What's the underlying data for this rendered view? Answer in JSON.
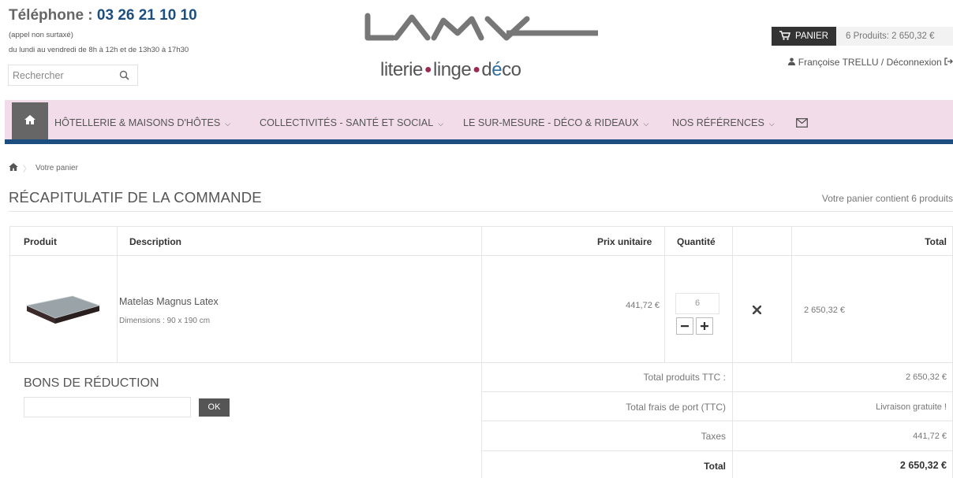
{
  "header": {
    "phone_label": "Téléphone : ",
    "phone_number": "03 26 21 10 10",
    "note1": "(appel non surtaxé)",
    "note2": "du lundi au vendredi de 8h à 12h et de 13h30 à 17h30",
    "search_placeholder": "Rechercher"
  },
  "logo": {
    "word1": "literie",
    "word2": "linge",
    "word3_start": "d",
    "word3_accent": "é",
    "word3_end": "co"
  },
  "cart": {
    "button_label": "PANIER",
    "summary": "6 Produits: 2 650,32 €"
  },
  "user": {
    "text": "Françoise TRELLU / Déconnexion"
  },
  "nav": {
    "items": [
      "HÔTELLERIE & MAISONS D'HÔTES",
      "COLLECTIVITÉS - SANTÉ ET SOCIAL",
      "LE SUR-MESURE - DÉCO & RIDEAUX",
      "NOS RÉFÉRENCES"
    ]
  },
  "breadcrumb": {
    "current": "Votre panier"
  },
  "page": {
    "title": "RÉCAPITULATIF DE LA COMMANDE",
    "count_text": "Votre panier contient 6 produits"
  },
  "table": {
    "headers": {
      "product": "Produit",
      "description": "Description",
      "unit_price": "Prix unitaire",
      "quantity": "Quantité",
      "total": "Total"
    },
    "rows": [
      {
        "name": "Matelas Magnus Latex",
        "dimensions": "Dimensions : 90 x 190 cm",
        "unit_price": "441,72 €",
        "quantity": "6",
        "total": "2 650,32 €"
      }
    ]
  },
  "voucher": {
    "title": "BONS DE RÉDUCTION",
    "ok_label": "OK"
  },
  "summary": {
    "products_label": "Total produits TTC :",
    "products_value": "2 650,32 €",
    "shipping_label": "Total frais de port (TTC)",
    "shipping_value": "Livraison gratuite !",
    "taxes_label": "Taxes",
    "taxes_value": "441,72 €",
    "total_label": "Total",
    "total_value": "2 650,32 €"
  },
  "colors": {
    "brand_blue": "#1d4e80",
    "nav_background": "#f2dcea",
    "logo_accent": "#9b2a52"
  }
}
